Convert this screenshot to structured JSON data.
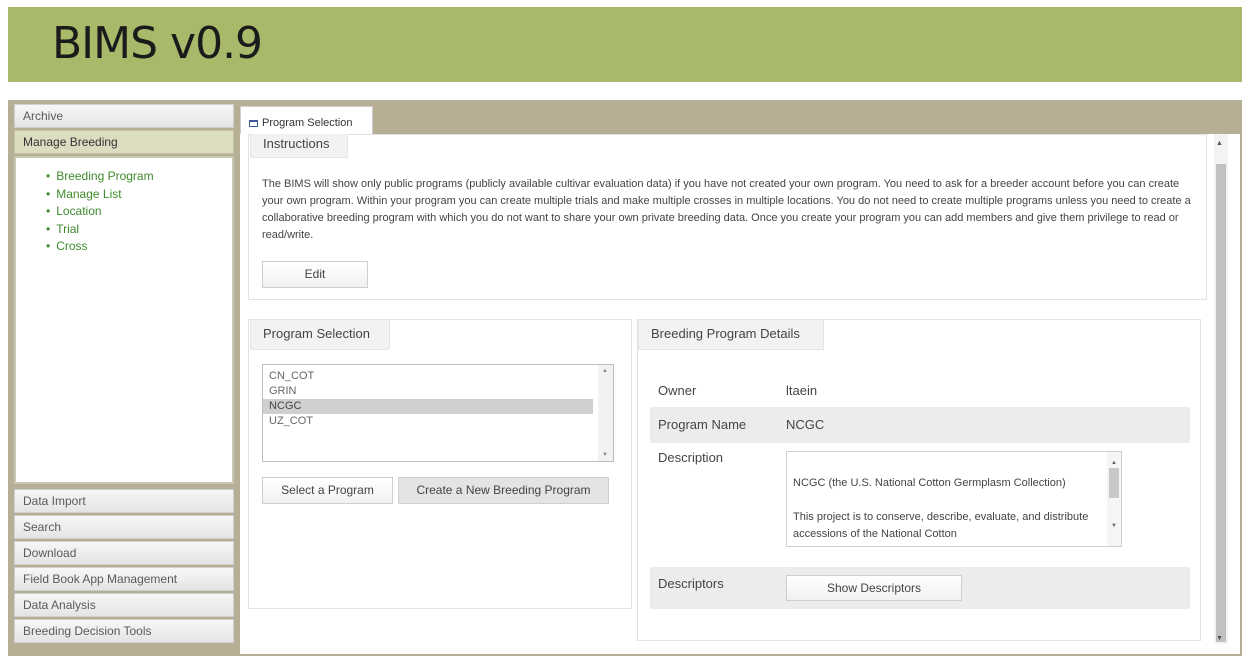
{
  "app": {
    "title": "BIMS v0.9"
  },
  "sidebar": {
    "archive": "Archive",
    "manage_breeding": "Manage Breeding",
    "links": [
      "Breeding Program",
      "Manage List",
      "Location",
      "Trial",
      "Cross"
    ],
    "sections": [
      "Data Import",
      "Search",
      "Download",
      "Field Book App Management",
      "Data Analysis",
      "Breeding Decision Tools"
    ]
  },
  "tab": {
    "label": "Program Selection"
  },
  "instructions": {
    "title": "Instructions",
    "text": "The BIMS will show only public programs (publicly available cultivar evaluation data) if you have not created your own program. You need to ask for a breeder account before you can create your own program. Within your program you can create multiple trials and make multiple crosses in multiple locations. You do not need to create multiple programs unless you need to create a collaborative breeding program with which you do not want to share your own private breeding data. Once you create your program you can add members and give them privilege to read or read/write.",
    "edit_label": "Edit"
  },
  "program_selection": {
    "title": "Program Selection",
    "options": [
      "CN_COT",
      "GRIN",
      "NCGC",
      "UZ_COT"
    ],
    "selected": "NCGC",
    "select_label": "Select a Program",
    "create_label": "Create a New Breeding Program"
  },
  "details": {
    "title": "Breeding Program Details",
    "owner_label": "Owner",
    "owner_value": "ltaein",
    "name_label": "Program Name",
    "name_value": "NCGC",
    "description_label": "Description",
    "description_text": "NCGC (the U.S. National Cotton Germplasm Collection)\n\nThis project is to conserve, describe, evaluate, and distribute accessions of the National Cotton",
    "descriptors_label": "Descriptors",
    "show_descriptors_label": "Show Descriptors"
  },
  "colors": {
    "banner": "#a8b96a",
    "frame": "#b6ae95",
    "link": "#3f8a2d",
    "active_header": "#dcdcc0",
    "selected_option": "#cfcfcf"
  }
}
